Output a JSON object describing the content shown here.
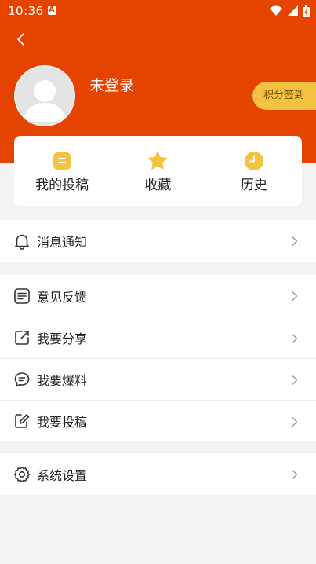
{
  "status": {
    "time": "10:36"
  },
  "profile": {
    "username": "未登录",
    "checkin_label": "积分签到"
  },
  "quick": [
    {
      "label": "我的投稿",
      "icon": "doc-icon"
    },
    {
      "label": "收藏",
      "icon": "star-icon"
    },
    {
      "label": "历史",
      "icon": "clock-icon"
    }
  ],
  "menu": {
    "notification": "消息通知",
    "feedback": "意见反馈",
    "share": "我要分享",
    "report": "我要爆料",
    "submit": "我要投稿",
    "settings": "系统设置"
  },
  "colors": {
    "header": "#e54400",
    "accent": "#f5c242",
    "background": "#f3f3f3"
  }
}
